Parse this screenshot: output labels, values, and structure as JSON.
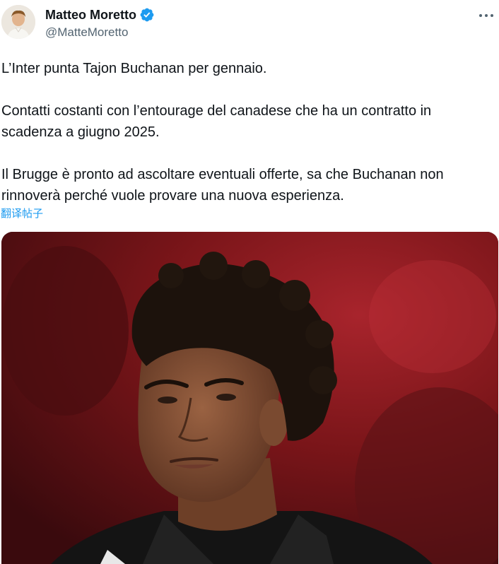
{
  "author": {
    "display_name": "Matteo Moretto",
    "handle": "@MatteMoretto",
    "verified": true,
    "avatar_icon": "user-avatar"
  },
  "tweet": {
    "paragraphs": [
      [
        "L’Inter punta Tajon Buchanan per gennaio."
      ],
      [
        "Contatti costanti con l’entourage del canadese che ha un contratto in",
        "scadenza a giugno 2025."
      ],
      [
        "Il Brugge è pronto ad ascoltare eventuali offerte, sa che Buchanan non",
        "rinnoverà perché vuole provare una nuova esperienza."
      ]
    ],
    "translate_label": "翻译帖子"
  },
  "media": {
    "type": "photo",
    "description_icon": "player-portrait"
  },
  "colors": {
    "accent": "#1d9bf0",
    "text": "#0f1419",
    "secondary": "#536471"
  }
}
